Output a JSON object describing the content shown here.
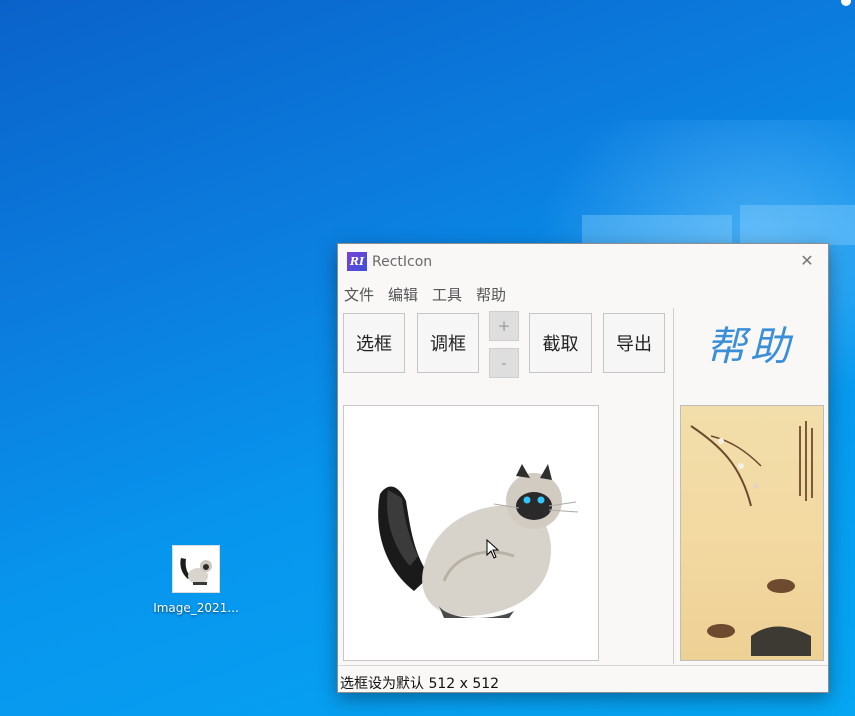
{
  "desktop": {
    "icon_label": "Image_2021..."
  },
  "window": {
    "app_icon": "RI",
    "title": "RectIcon",
    "close": "✕"
  },
  "menu": {
    "file": "文件",
    "edit": "编辑",
    "tools": "工具",
    "help": "帮助"
  },
  "toolbar": {
    "select": "选框",
    "adjust": "调框",
    "plus": "+",
    "minus": "-",
    "capture": "截取",
    "export": "导出"
  },
  "help_panel": {
    "text": "帮助"
  },
  "status": {
    "text": "选框设为默认 512 x 512"
  },
  "colors": {
    "desktop_blue": "#0796ee",
    "help_blue": "#3a8fd8"
  },
  "icons": {
    "close": "close-icon",
    "app": "app-icon",
    "cursor": "cursor-arrow-icon"
  }
}
